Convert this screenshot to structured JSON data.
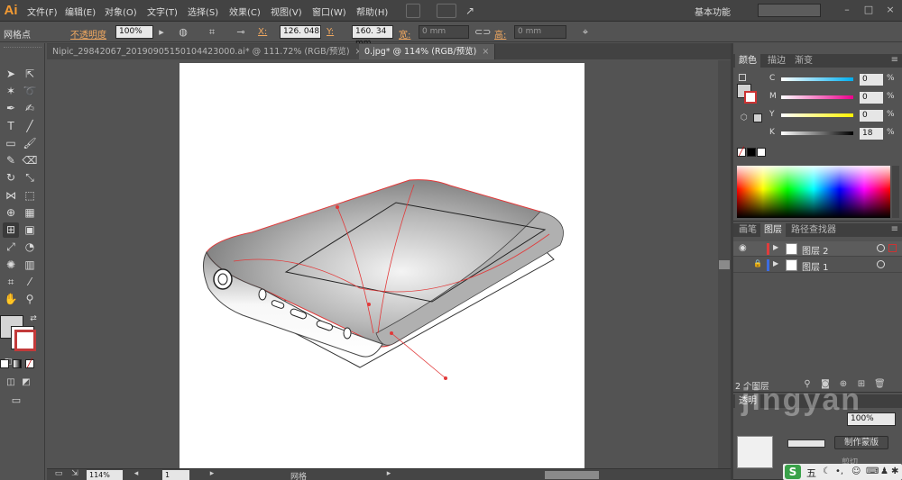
{
  "app": {
    "logo": "Ai"
  },
  "menu": [
    "文件(F)",
    "编辑(E)",
    "对象(O)",
    "文字(T)",
    "选择(S)",
    "效果(C)",
    "视图(V)",
    "窗口(W)",
    "帮助(H)"
  ],
  "workspace": "基本功能",
  "control_bar": {
    "mode_label": "网格点",
    "opacity_label": "不透明度",
    "opacity_value": "100%",
    "x_label": "X:",
    "x_value": "126. 048",
    "y_label": "Y:",
    "y_value": "160. 34 mm",
    "w_label": "宽:",
    "w_value": "0 mm",
    "h_label": "高:",
    "h_value": "0 mm"
  },
  "tabs": [
    {
      "label": "Nipic_29842067_20190905150104423000.ai* @ 111.72% (RGB/预览)",
      "active": false,
      "close": "×"
    },
    {
      "label": "0.jpg* @ 114% (RGB/预览)",
      "active": true,
      "close": "×"
    }
  ],
  "status": {
    "zoom": "114%",
    "page": "1",
    "tool": "网格"
  },
  "color_panel": {
    "tabs": [
      "颜色",
      "描边",
      "渐变"
    ],
    "channels": [
      {
        "letter": "C",
        "value": "0",
        "colors": [
          "#ffffff",
          "#00aeef"
        ]
      },
      {
        "letter": "M",
        "value": "0",
        "colors": [
          "#ffffff",
          "#ec008c"
        ]
      },
      {
        "letter": "Y",
        "value": "0",
        "colors": [
          "#ffffff",
          "#fff200"
        ]
      },
      {
        "letter": "K",
        "value": "18",
        "colors": [
          "#ffffff",
          "#000000"
        ]
      }
    ],
    "percent": "%"
  },
  "layers_panel": {
    "tabs": [
      "画笔",
      "图层",
      "路径查找器"
    ],
    "layers": [
      {
        "name": "图层 2",
        "color": "#e03c3c",
        "selected": true,
        "eye": "◉",
        "lock": ""
      },
      {
        "name": "图层 1",
        "color": "#3c6ce0",
        "selected": false,
        "eye": "",
        "lock": "🔒"
      }
    ],
    "count_label": "2 个图层"
  },
  "transparency_panel": {
    "tab": "透明",
    "opacity_value": "100%",
    "make_mask": "制作蒙版",
    "clip": "剪切"
  },
  "watermark": "jingyan",
  "taskbar": {
    "ime": "S",
    "ime_mode": "五"
  }
}
